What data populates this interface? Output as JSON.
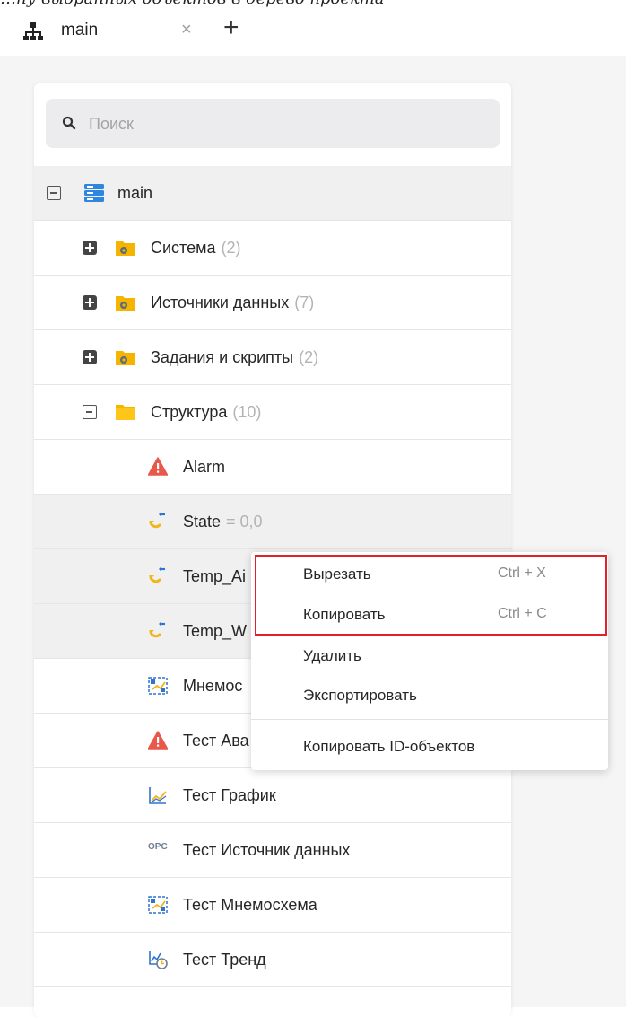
{
  "caption": "…ну выбранных объектов в дерево проекта",
  "tab": {
    "label": "main",
    "close": "×",
    "add": "+"
  },
  "search": {
    "placeholder": "Поиск"
  },
  "tree": {
    "root": {
      "label": "main"
    },
    "folders": [
      {
        "label": "Система",
        "count": "(2)",
        "state": "collapsed"
      },
      {
        "label": "Источники данных",
        "count": "(7)",
        "state": "collapsed"
      },
      {
        "label": "Задания и скрипты",
        "count": "(2)",
        "state": "collapsed"
      },
      {
        "label": "Структура",
        "count": "(10)",
        "state": "expanded"
      }
    ],
    "items": [
      {
        "label": "Alarm",
        "icon": "alarm-icon"
      },
      {
        "label": "State",
        "value": "= 0,0",
        "icon": "tag-icon"
      },
      {
        "label": "Temp_Ai",
        "icon": "tag-icon"
      },
      {
        "label": "Temp_W",
        "icon": "tag-icon"
      },
      {
        "label": "Мнемос",
        "icon": "mnemonic-icon"
      },
      {
        "label": "Тест Ава",
        "icon": "alarm-icon"
      },
      {
        "label": "Тест График",
        "icon": "chart-icon"
      },
      {
        "label": "Тест Источник данных",
        "icon": "opc-icon",
        "icon_text": "OPC"
      },
      {
        "label": "Тест Мнемосхема",
        "icon": "mnemonic-icon"
      },
      {
        "label": "Тест Тренд",
        "icon": "trend-icon"
      }
    ]
  },
  "context_menu": {
    "items": [
      {
        "label": "Вырезать",
        "shortcut": "Ctrl + X"
      },
      {
        "label": "Копировать",
        "shortcut": "Ctrl + C"
      },
      {
        "label": "Удалить",
        "shortcut": ""
      },
      {
        "label": "Экспортировать",
        "shortcut": ""
      },
      {
        "label": "Копировать ID-объектов",
        "shortcut": ""
      }
    ]
  },
  "colors": {
    "highlight_border": "#e0202b",
    "folder_yellow": "#f5b400",
    "alarm_red": "#e8584b",
    "tag_blue": "#2f73d0",
    "tag_yellow": "#f2b51a",
    "server_blue": "#2f86e0"
  }
}
